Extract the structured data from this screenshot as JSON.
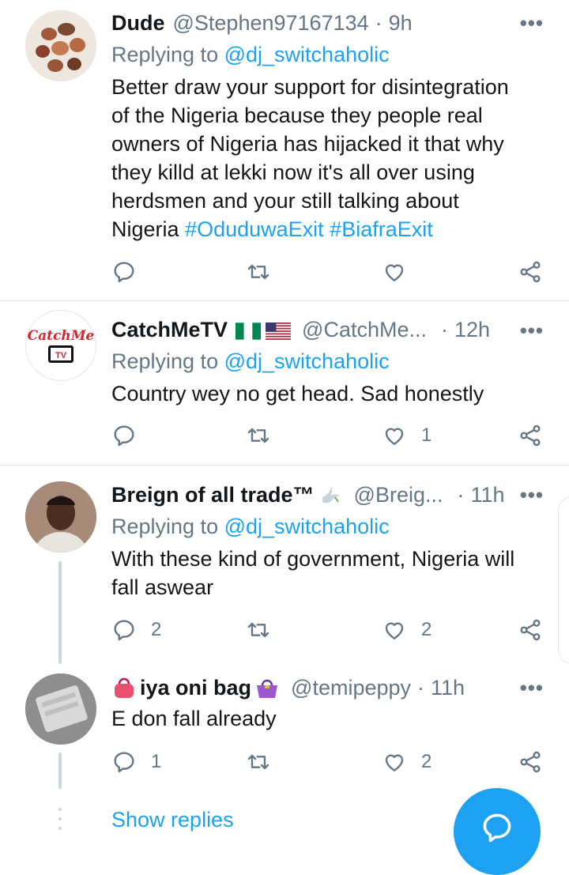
{
  "tweets": [
    {
      "name": "Dude",
      "handle": "@Stephen97167134",
      "time": "9h",
      "replying_prefix": "Replying to",
      "replying_to": "@dj_switchaholic",
      "text_lines": [
        "Better draw your support for disintegration",
        "of the Nigeria because they people real",
        "owners of Nigeria has hijacked it that why",
        "they killd at lekki now it's all over using",
        "herdsmen and your still talking about"
      ],
      "text_last": "Nigeria",
      "hashtags": [
        "#OduduwaExit",
        "#BiafraExit"
      ],
      "reply_count": "",
      "retweet_count": "",
      "like_count": ""
    },
    {
      "name": "CatchMeTV",
      "handle": "@CatchMe...",
      "time": "12h",
      "replying_prefix": "Replying to",
      "replying_to": "@dj_switchaholic",
      "text": "Country wey no get head. Sad honestly",
      "avatar_text": "CatchMe",
      "avatar_tv": "TV",
      "reply_count": "",
      "retweet_count": "",
      "like_count": "1"
    },
    {
      "name": "Breign of all trade™",
      "handle": "@Breig...",
      "time": "11h",
      "replying_prefix": "Replying to",
      "replying_to": "@dj_switchaholic",
      "text_lines": [
        "With these kind of government, Nigeria will",
        "fall aswear"
      ],
      "reply_count": "2",
      "retweet_count": "",
      "like_count": "2"
    },
    {
      "name": "iya oni bag",
      "handle": "@temipeppy",
      "time": "11h",
      "text": "E don fall already",
      "reply_count": "1",
      "retweet_count": "",
      "like_count": "2"
    }
  ],
  "separator": "·",
  "more_label": "•••",
  "show_replies": "Show replies",
  "colors": {
    "accent": "#1da1f2",
    "muted": "#657786",
    "divider": "#e1e8ed"
  },
  "icons": [
    "reply-icon",
    "retweet-icon",
    "like-icon",
    "share-icon",
    "more-icon",
    "compose-icon"
  ]
}
